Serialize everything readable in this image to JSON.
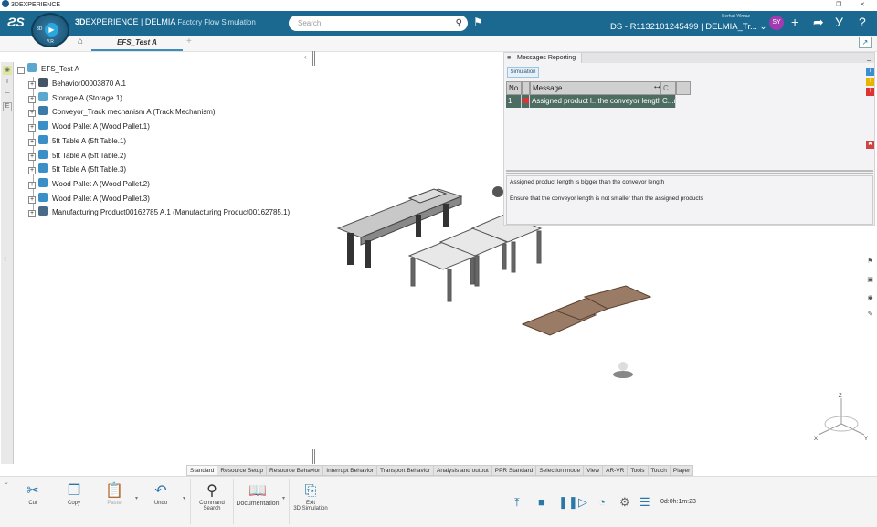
{
  "window": {
    "title": "3DEXPERIENCE",
    "controls": [
      "minimize",
      "restore",
      "close"
    ]
  },
  "header": {
    "brand": "3D",
    "brand_rest": "EXPERIENCE | DELMIA",
    "app": "Factory Flow Simulation",
    "search_placeholder": "Search",
    "tenant": "DS - R1132101245499 | DELMIA_Tr...",
    "user": "Serhat Yilmaz",
    "avatar": "SY",
    "compass_labels": {
      "left": "3D",
      "bottom": "V.R"
    }
  },
  "tabs": {
    "active": "EFS_Test A",
    "add": "+"
  },
  "tree": {
    "root": "EFS_Test A",
    "items": [
      {
        "label": "Behavior00003870 A.1",
        "icon": "behavior-icon"
      },
      {
        "label": "Storage A (Storage.1)",
        "icon": "storage-icon"
      },
      {
        "label": "Conveyor_Track mechanism A (Track Mechanism)",
        "icon": "conveyor-icon"
      },
      {
        "label": "Wood Pallet A (Wood Pallet.1)",
        "icon": "part-icon"
      },
      {
        "label": "5ft Table A (5ft Table.1)",
        "icon": "part-icon"
      },
      {
        "label": "5ft Table A (5ft Table.2)",
        "icon": "part-icon"
      },
      {
        "label": "5ft Table A (5ft Table.3)",
        "icon": "part-icon"
      },
      {
        "label": "Wood Pallet A (Wood Pallet.2)",
        "icon": "part-icon"
      },
      {
        "label": "Wood Pallet A (Wood Pallet.3)",
        "icon": "part-icon"
      },
      {
        "label": "Manufacturing Product00162785 A.1 (Manufacturing Product00162785.1)",
        "icon": "product-icon"
      }
    ]
  },
  "messages": {
    "panel_title": "Messages Reporting",
    "filter": "Simulation",
    "columns": [
      "No",
      "",
      "Message",
      "C..."
    ],
    "rows": [
      {
        "no": "1",
        "message": "Assigned product l...the conveyor length",
        "col": "C...m"
      }
    ],
    "detail_line1": "Assigned product length is bigger than the conveyor length",
    "detail_line2": "Ensure that the conveyor length is not smaller than the assigned products"
  },
  "ribbon": {
    "tabs": [
      "Standard",
      "Resource Setup",
      "Resource Behavior",
      "Interrupt Behavior",
      "Transport Behavior",
      "Analysis and output",
      "PPR Standard",
      "Selection mode",
      "View",
      "AR-VR",
      "Tools",
      "Touch",
      "Player"
    ],
    "active": "Standard",
    "tools": {
      "cut": "Cut",
      "copy": "Copy",
      "paste": "Paste",
      "undo": "Undo",
      "command_search_1": "Command",
      "command_search_2": "Search",
      "documentation": "Documentation",
      "exit_1": "Exit",
      "exit_2": "3D Simulation"
    }
  },
  "player": {
    "time": "0d:0h:1m:23"
  },
  "axis": {
    "x": "X",
    "y": "Y",
    "z": "Z"
  },
  "colors": {
    "header": "#1b6991",
    "avatar": "#a23bb0",
    "row_selected": "#4d6d62"
  }
}
